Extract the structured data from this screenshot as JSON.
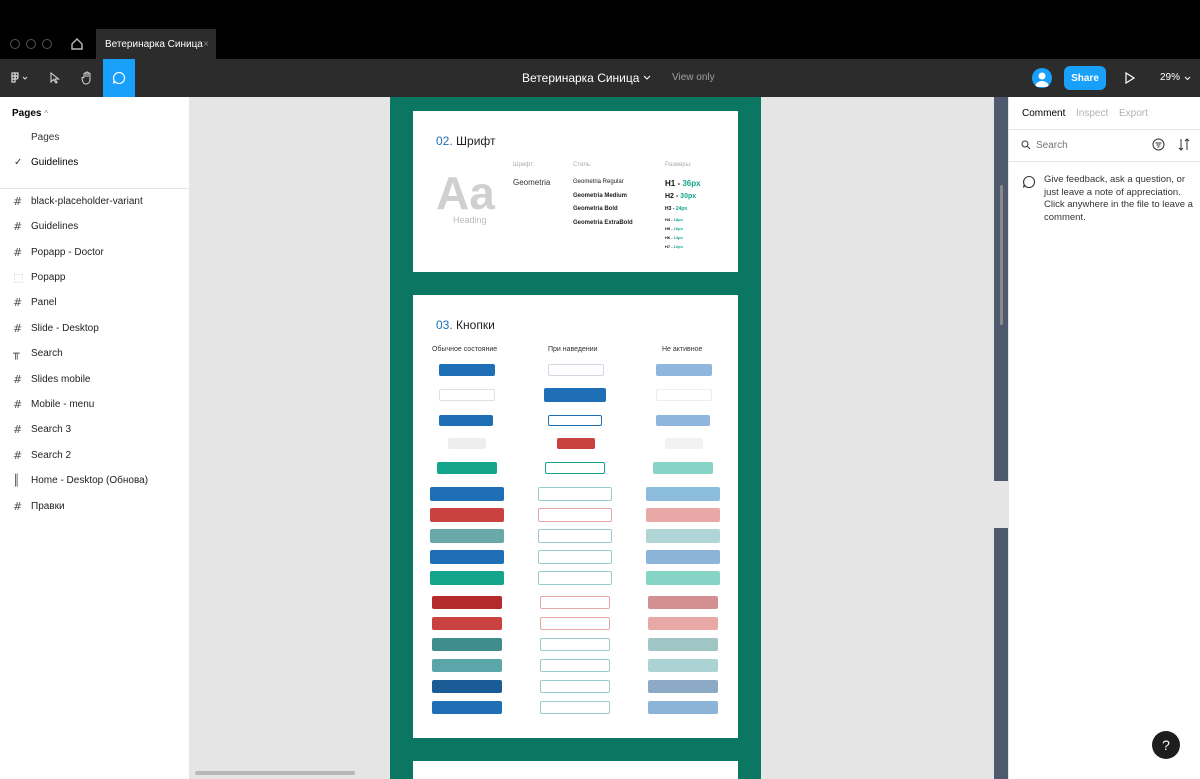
{
  "window": {
    "tab_title": "Ветеринарка Синица",
    "tab_close": "×"
  },
  "toolbar": {
    "file_title": "Ветеринарка Синица",
    "view_only": "View only",
    "share_label": "Share",
    "zoom": "29%"
  },
  "left_panel": {
    "pages_header": "Pages",
    "pages": [
      {
        "label": "Pages",
        "selected": false
      },
      {
        "label": "Guidelines",
        "selected": true
      }
    ],
    "frames": [
      {
        "icon": "#",
        "label": "black-placeholder-variant"
      },
      {
        "icon": "#",
        "label": "Guidelines"
      },
      {
        "icon": "#",
        "label": "Popapp - Doctor"
      },
      {
        "icon": "⬚",
        "label": "Popapp"
      },
      {
        "icon": "#",
        "label": "Panel"
      },
      {
        "icon": "#",
        "label": "Slide - Desktop"
      },
      {
        "icon": "╥",
        "label": "Search"
      },
      {
        "icon": "#",
        "label": "Slides mobile"
      },
      {
        "icon": "#",
        "label": "Mobile - menu"
      },
      {
        "icon": "#",
        "label": "Search 3"
      },
      {
        "icon": "#",
        "label": "Search 2"
      },
      {
        "icon": "║",
        "label": "Home - Desktop (Обнова)"
      },
      {
        "icon": "#",
        "label": "Правки"
      }
    ]
  },
  "canvas": {
    "font_section": {
      "number": "02.",
      "title": "Шрифт",
      "sample_glyph": "Aa",
      "sample_caption": "Heading",
      "col_font_label": "Шрифт:",
      "font_name": "Geometria",
      "col_style_label": "Стиль:",
      "styles": [
        "Geometria Regular",
        "Geometria Medium",
        "Geometria Bold",
        "Geometria ExtraBold"
      ],
      "col_size_label": "Размеры:",
      "sizes": [
        {
          "name": "H1 - ",
          "value": "36px"
        },
        {
          "name": "H2 - ",
          "value": "30px"
        },
        {
          "name": "H3 - ",
          "value": "24px"
        },
        {
          "name": "H4 - ",
          "value": "18px"
        },
        {
          "name": "H5 - ",
          "value": "16px"
        },
        {
          "name": "H6 - ",
          "value": "14px"
        },
        {
          "name": "H7 - ",
          "value": "12px"
        }
      ]
    },
    "buttons_section": {
      "number": "03.",
      "title": "Кнопки",
      "col_normal": "Обычное состояние",
      "col_hover": "При наведении",
      "col_disabled": "Не активное"
    }
  },
  "right_panel": {
    "tabs": [
      "Comment",
      "Inspect",
      "Export"
    ],
    "active_tab": "Comment",
    "search_placeholder": "Search",
    "hint": "Give feedback, ask a question, or just leave a note of appreciation. Click anywhere in the file to leave a comment."
  },
  "colors": {
    "accent": "#18a0fb",
    "canvas_green": "#0b7661",
    "blue": "#1e6fb5",
    "red": "#c9423f",
    "teal": "#14a58c"
  }
}
